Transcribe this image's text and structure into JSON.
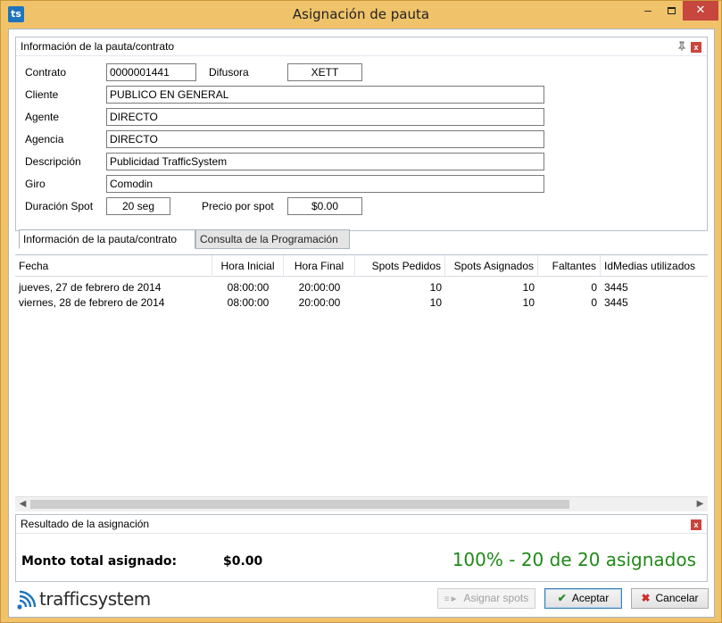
{
  "window": {
    "title": "Asignación de pauta",
    "app_icon": "ts",
    "close_glyph": "✕",
    "min_glyph": "–"
  },
  "info_panel": {
    "title": "Información de la pauta/contrato",
    "contrato_label": "Contrato",
    "contrato_value": "0000001441",
    "difusora_label": "Difusora",
    "difusora_value": "XETT",
    "cliente_label": "Cliente",
    "cliente_value": "PUBLICO EN GENERAL",
    "agente_label": "Agente",
    "agente_value": "DIRECTO",
    "agencia_label": "Agencia",
    "agencia_value": "DIRECTO",
    "descripcion_label": "Descripción",
    "descripcion_value": "Publicidad TrafficSystem",
    "giro_label": "Giro",
    "giro_value": "Comodin",
    "duracion_label": "Duración Spot",
    "duracion_value": "20 seg",
    "precio_label": "Precio por spot",
    "precio_value": "$0.00"
  },
  "tabs": [
    {
      "label": "Información de la pauta/contrato"
    },
    {
      "label": "Consulta de la Programación"
    }
  ],
  "grid": {
    "columns": [
      "Fecha",
      "Hora Inicial",
      "Hora Final",
      "Spots Pedidos",
      "Spots Asignados",
      "Faltantes",
      "IdMedias utilizados"
    ],
    "rows": [
      [
        "jueves, 27 de febrero de 2014",
        "08:00:00",
        "20:00:00",
        "10",
        "10",
        "0",
        "3445"
      ],
      [
        "viernes, 28 de febrero de 2014",
        "08:00:00",
        "20:00:00",
        "10",
        "10",
        "0",
        "3445"
      ]
    ]
  },
  "result_panel": {
    "title": "Resultado de la asignación",
    "monto_label": "Monto total asignado:",
    "monto_value": "$0.00",
    "resumen": "100% - 20 de 20 asignados",
    "resumen_color": "#1f8a17"
  },
  "footer": {
    "brand": "trafficsystem",
    "assign_button": "Asignar spots",
    "accept_button": "Aceptar",
    "cancel_button": "Cancelar"
  },
  "icons": {
    "app": "ts-logo-icon",
    "pin": "pin-icon",
    "close": "close-icon",
    "check": "check-icon",
    "cancel": "x-icon",
    "assign": "assign-icon",
    "brand": "wifi-signal-icon"
  }
}
